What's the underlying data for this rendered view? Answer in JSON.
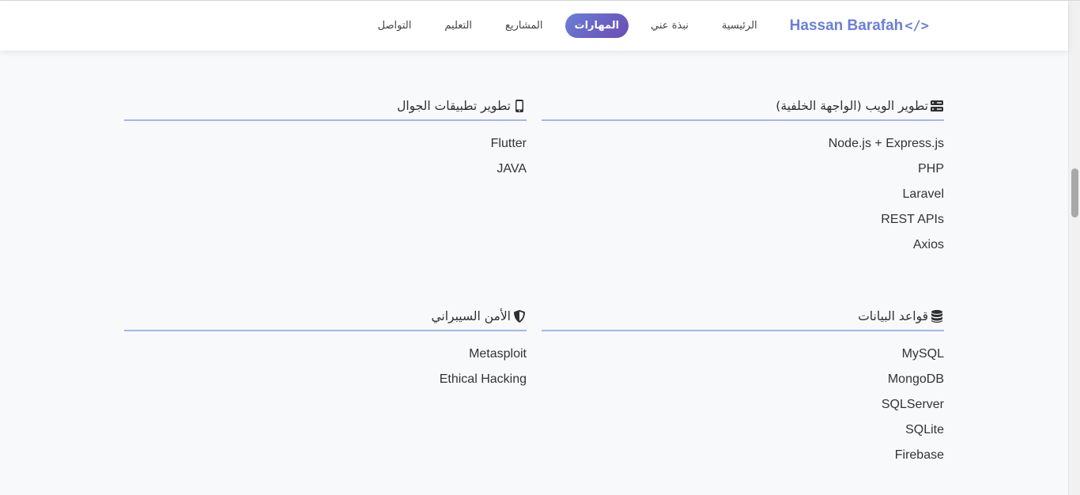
{
  "nav": {
    "brand_name": "Hassan Barafah",
    "brand_code": "</>",
    "links": [
      {
        "label": "الرئيسية",
        "active": false
      },
      {
        "label": "نبذة عني",
        "active": false
      },
      {
        "label": "المهارات",
        "active": true
      },
      {
        "label": "المشاريع",
        "active": false
      },
      {
        "label": "التعليم",
        "active": false
      },
      {
        "label": "التواصل",
        "active": false
      }
    ]
  },
  "skills": {
    "backend": {
      "icon": "server-icon",
      "title": "تطوير الويب (الواجهة الخلفية)",
      "items": [
        "Node.js + Express.js",
        "PHP",
        "Laravel",
        "REST APIs",
        "Axios"
      ]
    },
    "mobile": {
      "icon": "mobile-phone-icon",
      "title": "تطوير تطبيقات الجوال",
      "items": [
        "Flutter",
        "JAVA"
      ]
    },
    "databases": {
      "icon": "database-icon",
      "title": "قواعد البيانات",
      "items": [
        "MySQL",
        "MongoDB",
        "SQLServer",
        "SQLite",
        "Firebase"
      ]
    },
    "security": {
      "icon": "shield-icon",
      "title": "الأمن السيبراني",
      "items": [
        "Metasploit",
        "Ethical Hacking"
      ]
    }
  },
  "colors": {
    "brand": "#6a7fd6",
    "active_gradient_start": "#6a7fd6",
    "active_gradient_end": "#6b4bb5",
    "divider": "#a9b6e6"
  }
}
